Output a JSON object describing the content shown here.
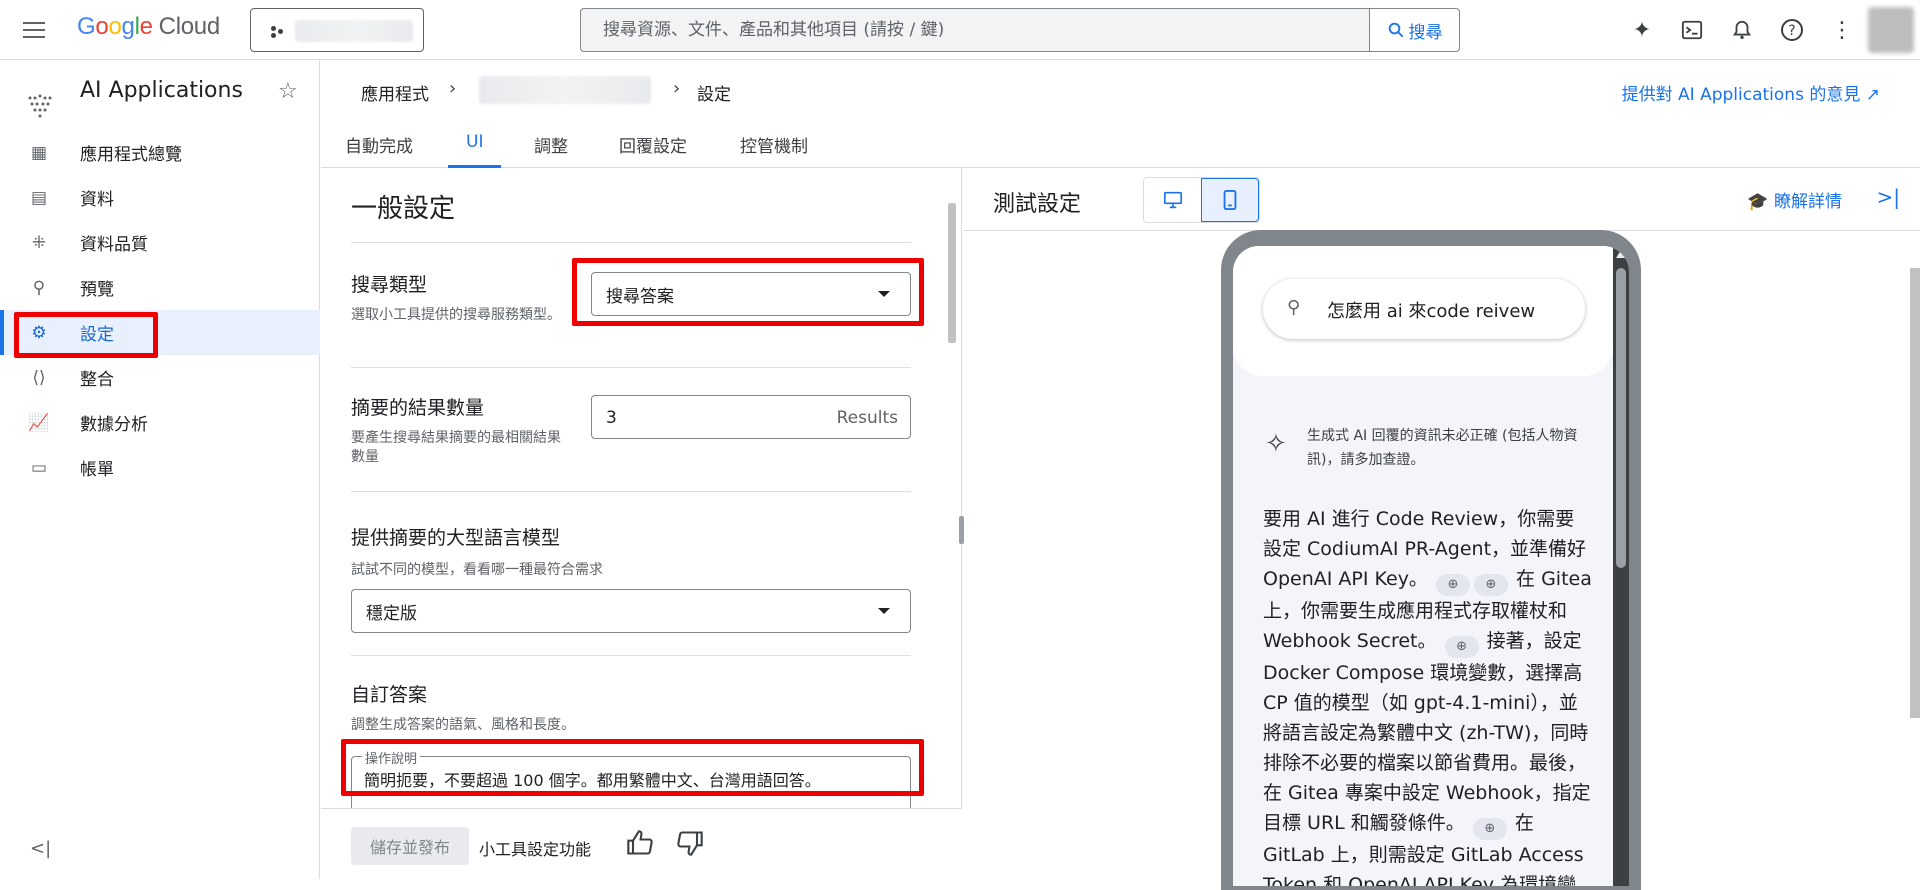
{
  "topbar": {
    "logo_google": "Google",
    "logo_cloud": "Cloud",
    "search_placeholder": "搜尋資源、文件、產品和其他項目 (請按 / 鍵)",
    "search_button": "搜尋"
  },
  "sidebar": {
    "product_name": "AI Applications",
    "items": [
      {
        "label": "應用程式總覽",
        "icon": "dashboard-icon"
      },
      {
        "label": "資料",
        "icon": "data-icon"
      },
      {
        "label": "資料品質",
        "icon": "data-quality-icon"
      },
      {
        "label": "預覽",
        "icon": "search-icon"
      },
      {
        "label": "設定",
        "icon": "gear-icon",
        "active": true
      },
      {
        "label": "整合",
        "icon": "code-icon"
      },
      {
        "label": "數據分析",
        "icon": "analytics-icon"
      },
      {
        "label": "帳單",
        "icon": "billing-icon"
      }
    ],
    "collapse_icon": "collapse-icon"
  },
  "breadcrumb": {
    "root": "應用程式",
    "current": "設定",
    "feedback_link": "提供對 AI Applications 的意見"
  },
  "tabs": [
    "自動完成",
    "UI",
    "調整",
    "回覆設定",
    "控管機制"
  ],
  "active_tab": "UI",
  "general": {
    "title": "一般設定",
    "search_type": {
      "label": "搜尋類型",
      "help": "選取小工具提供的搜尋服務類型。",
      "value": "搜尋答案"
    },
    "summary_count": {
      "label": "摘要的結果數量",
      "help": "要產生搜尋結果摘要的最相關結果數量",
      "value": "3",
      "unit": "Results"
    },
    "llm": {
      "label": "提供摘要的大型語言模型",
      "help": "試試不同的模型，看看哪一種最符合需求",
      "value": "穩定版"
    },
    "custom_answer": {
      "label": "自訂答案",
      "help": "調整生成答案的語氣、風格和長度。",
      "field_label": "操作說明",
      "value": "簡明扼要，不要超過 100 個字。都用繁體中文、台灣用語回答。"
    }
  },
  "footer": {
    "publish_button": "儲存並發布",
    "widget_text": "小工具設定功能"
  },
  "test": {
    "title": "測試設定",
    "learn_more": "瞭解詳情",
    "query": "怎麼用 ai 來code reivew",
    "disclaimer": "生成式 AI 回覆的資訊未必正確 (包括人物資訊)，請多加查證。",
    "answer": [
      "要用 AI 進行 Code Review，你需要設定 CodiumAI PR-Agent，並準備好 OpenAI API Key。",
      "在 Gitea 上，你需要生成應用程式存取權杖和 Webhook Secret。",
      "接著，設定 Docker Compose 環境變數，選擇高 CP 值的模型（如 gpt-4.1-mini），並將語言設定為繁體中文 (zh-TW)，同時排除不必要的檔案以節省費用。最後，在 Gitea 專案中設定 Webhook，指定目標 URL 和觸發條件。",
      "在 GitLab 上，則需設定 GitLab Access Token 和 OpenAI API Key 為環境變數，並提交"
    ]
  },
  "colors": {
    "accent": "#1a73e8",
    "highlight_box": "#ee0000"
  }
}
